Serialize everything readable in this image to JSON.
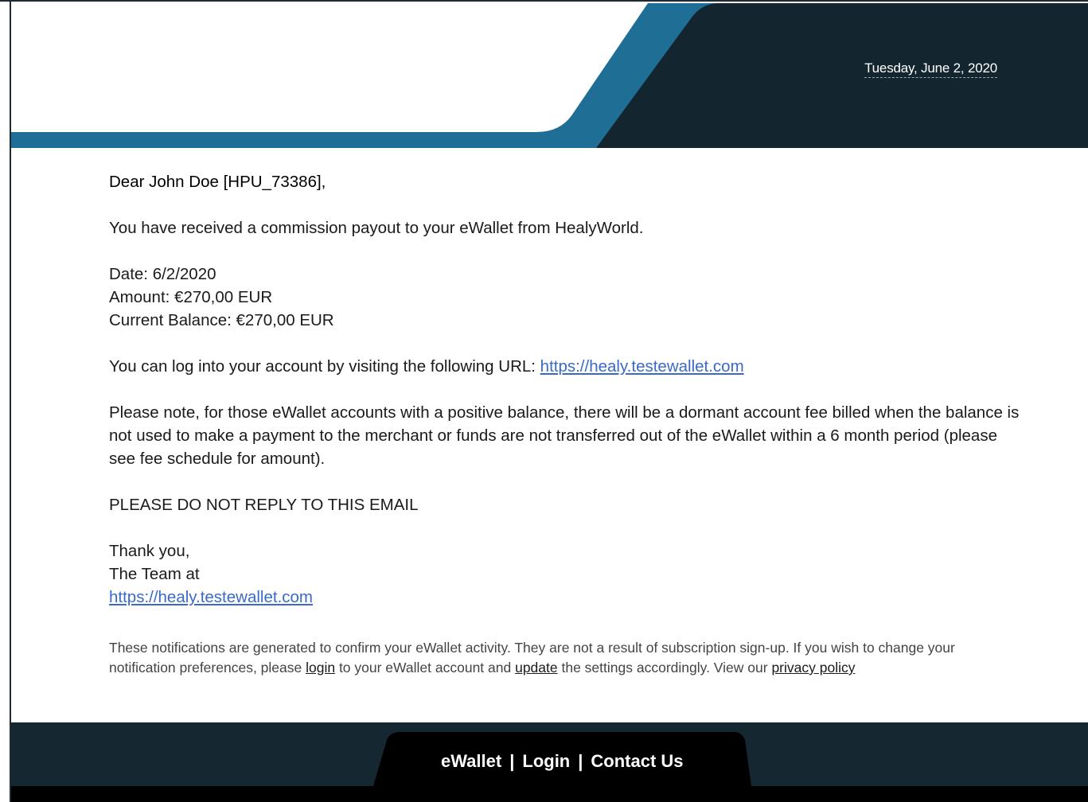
{
  "header": {
    "date": "Tuesday, June 2, 2020"
  },
  "email": {
    "greeting": "Dear John Doe [HPU_73386],",
    "intro": "You have received a commission payout to your eWallet from HealyWorld.",
    "date_line": "Date: 6/2/2020",
    "amount_line": "Amount: €270,00 EUR",
    "balance_line": "Current Balance: €270,00 EUR",
    "login_text": "You can log into your account by visiting the following URL: ",
    "login_url": "https://healy.testewallet.com",
    "note": "Please note, for those eWallet accounts with a positive balance, there will be a dormant account fee billed when the balance is not used to make a payment to the merchant or funds are not transferred out of the eWallet within a 6 month period (please see fee schedule for amount).",
    "no_reply": "PLEASE DO NOT REPLY TO THIS EMAIL",
    "thanks": "Thank you,",
    "team": "The Team at",
    "team_url": "https://healy.testewallet.com"
  },
  "notice": {
    "text1": "These notifications are generated to confirm your eWallet activity. They are not a result of subscription sign-up. If you wish to change your notification preferences, please ",
    "login_link": "login",
    "text2": " to your eWallet account and ",
    "update_link": "update",
    "text3": " the settings accordingly. View our ",
    "privacy_link": "privacy policy"
  },
  "footer": {
    "ewallet": "eWallet",
    "login": "Login",
    "contact": "Contact Us",
    "separator": "|"
  },
  "colors": {
    "dark": "#13262f",
    "accent_blue": "#1f6e96",
    "link": "#3a6ac8"
  }
}
